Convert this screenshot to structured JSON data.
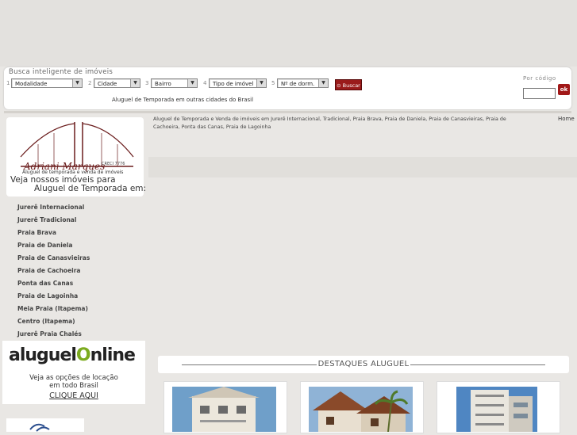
{
  "search": {
    "title": "Busca inteligente de imóveis",
    "steps": [
      {
        "num": "1",
        "label": "Modalidade"
      },
      {
        "num": "2",
        "label": "Cidade"
      },
      {
        "num": "3",
        "label": "Bairro"
      },
      {
        "num": "4",
        "label": "Tipo de imóvel"
      },
      {
        "num": "5",
        "label": "Nº de dorm."
      }
    ],
    "buscar_label": "Buscar",
    "outras_cidades": "Aluguel de Temporada em outras cidades do Brasil",
    "por_codigo": "Por código",
    "ok_label": "ok"
  },
  "logo": {
    "name": "Adriani Marques",
    "creci": "CRECI 7776",
    "tagline": "Aluguel de temporada e venda de imóveis"
  },
  "sidebar": {
    "veja_line1": "Veja nossos imóveis para",
    "veja_line2": "Aluguel de Temporada em:",
    "items": [
      "Jurerê Internacional",
      "Jurerê Tradicional",
      "Praia Brava",
      "Praia de Daniela",
      "Praia de Canasvieiras",
      "Praia de Cachoeira",
      "Ponta das Canas",
      "Praia de Lagoinha",
      "Meia Praia (Itapema)",
      "Centro (Itapema)",
      "Jurerê Praia Chalés"
    ]
  },
  "aluguel_online": {
    "logo_text_a": "aluguel",
    "logo_text_o": "O",
    "logo_text_b": "nline",
    "veja_line1": "Veja as opções de locação",
    "veja_line2": "em todo Brasil",
    "clique": "CLIQUE AQUI"
  },
  "main": {
    "breadcrumb": "Aluguel de Temporada e Venda de imóveis em Jurerê Internacional, Tradicional, Praia Brava, Praia de Daniela, Praia de Canasvieiras, Praia de Cachoeira, Ponta das Canas, Praia de Lagoinha",
    "home_link": "Home",
    "destaques_title": "DESTAQUES ALUGUEL"
  },
  "colors": {
    "accent_red": "#9a1b1b",
    "brand_green": "#7cab1f"
  }
}
